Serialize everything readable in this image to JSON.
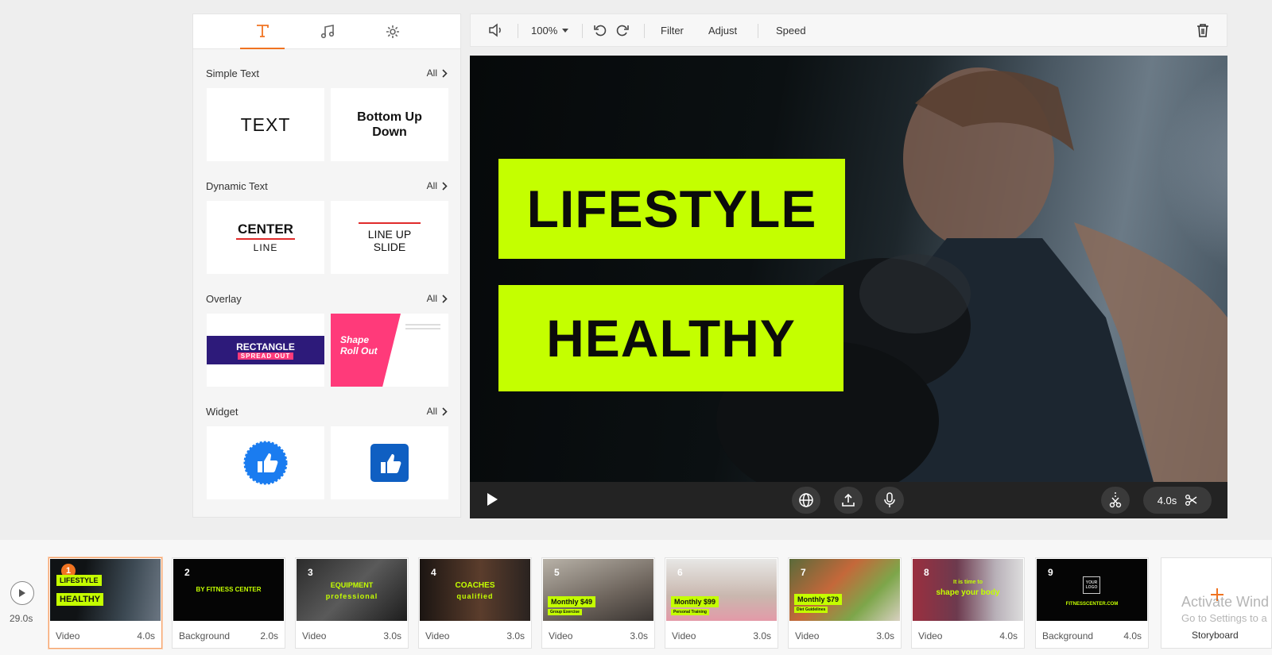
{
  "panel": {
    "tabs": [
      {
        "icon": "text-icon",
        "active": true
      },
      {
        "icon": "music-icon",
        "active": false
      },
      {
        "icon": "settings-icon",
        "active": false
      }
    ],
    "all_label": "All",
    "sections": {
      "simple_text": {
        "title": "Simple Text",
        "cards": [
          "TEXT",
          "Bottom Up Down"
        ]
      },
      "dynamic_text": {
        "title": "Dynamic Text",
        "card1_line1": "CENTER",
        "card1_line2": "LINE",
        "card2_line1": "LINE UP",
        "card2_line2": "SLIDE"
      },
      "overlay": {
        "title": "Overlay",
        "card1_line1": "RECTANGLE",
        "card1_line2": "SPREAD OUT",
        "card2_line1": "Shape",
        "card2_line2": "Roll Out"
      },
      "widget": {
        "title": "Widget"
      }
    }
  },
  "toolbar": {
    "zoom": "100%",
    "filter": "Filter",
    "adjust": "Adjust",
    "speed": "Speed"
  },
  "video": {
    "line1": "LIFESTYLE",
    "line2": "HEALTHY",
    "duration": "4.0s"
  },
  "timeline": {
    "total": "29.0s",
    "storyboard_label": "Storyboard",
    "clips": [
      {
        "num": "1",
        "type": "Video",
        "duration": "4.0s",
        "t1": "LIFESTYLE",
        "t2": "HEALTHY"
      },
      {
        "num": "2",
        "type": "Background",
        "duration": "2.0s",
        "t1": "BY FITNESS CENTER"
      },
      {
        "num": "3",
        "type": "Video",
        "duration": "3.0s",
        "t1": "EQUIPMENT",
        "t2": "professional"
      },
      {
        "num": "4",
        "type": "Video",
        "duration": "3.0s",
        "t1": "COACHES",
        "t2": "qualified"
      },
      {
        "num": "5",
        "type": "Video",
        "duration": "3.0s",
        "t1": "Monthly $49",
        "t2": "Group Exercise"
      },
      {
        "num": "6",
        "type": "Video",
        "duration": "3.0s",
        "t1": "Monthly $99",
        "t2": "Personal Training"
      },
      {
        "num": "7",
        "type": "Video",
        "duration": "3.0s",
        "t1": "Monthly $79",
        "t2": "Diet Guidelines"
      },
      {
        "num": "8",
        "type": "Video",
        "duration": "4.0s",
        "t1": "It is time to",
        "t2": "shape your body"
      },
      {
        "num": "9",
        "type": "Background",
        "duration": "4.0s",
        "t1": "YOUR LOGO",
        "t2": "FITNESSCENTER.COM"
      }
    ]
  },
  "watermark": {
    "line1": "Activate Wind",
    "line2": "Go to Settings to a"
  },
  "colors": {
    "accent": "#f07321",
    "lime": "#c4ff00",
    "navy": "#2d1a7a",
    "pink": "#ff3a7a",
    "blue": "#1a7cf0"
  }
}
